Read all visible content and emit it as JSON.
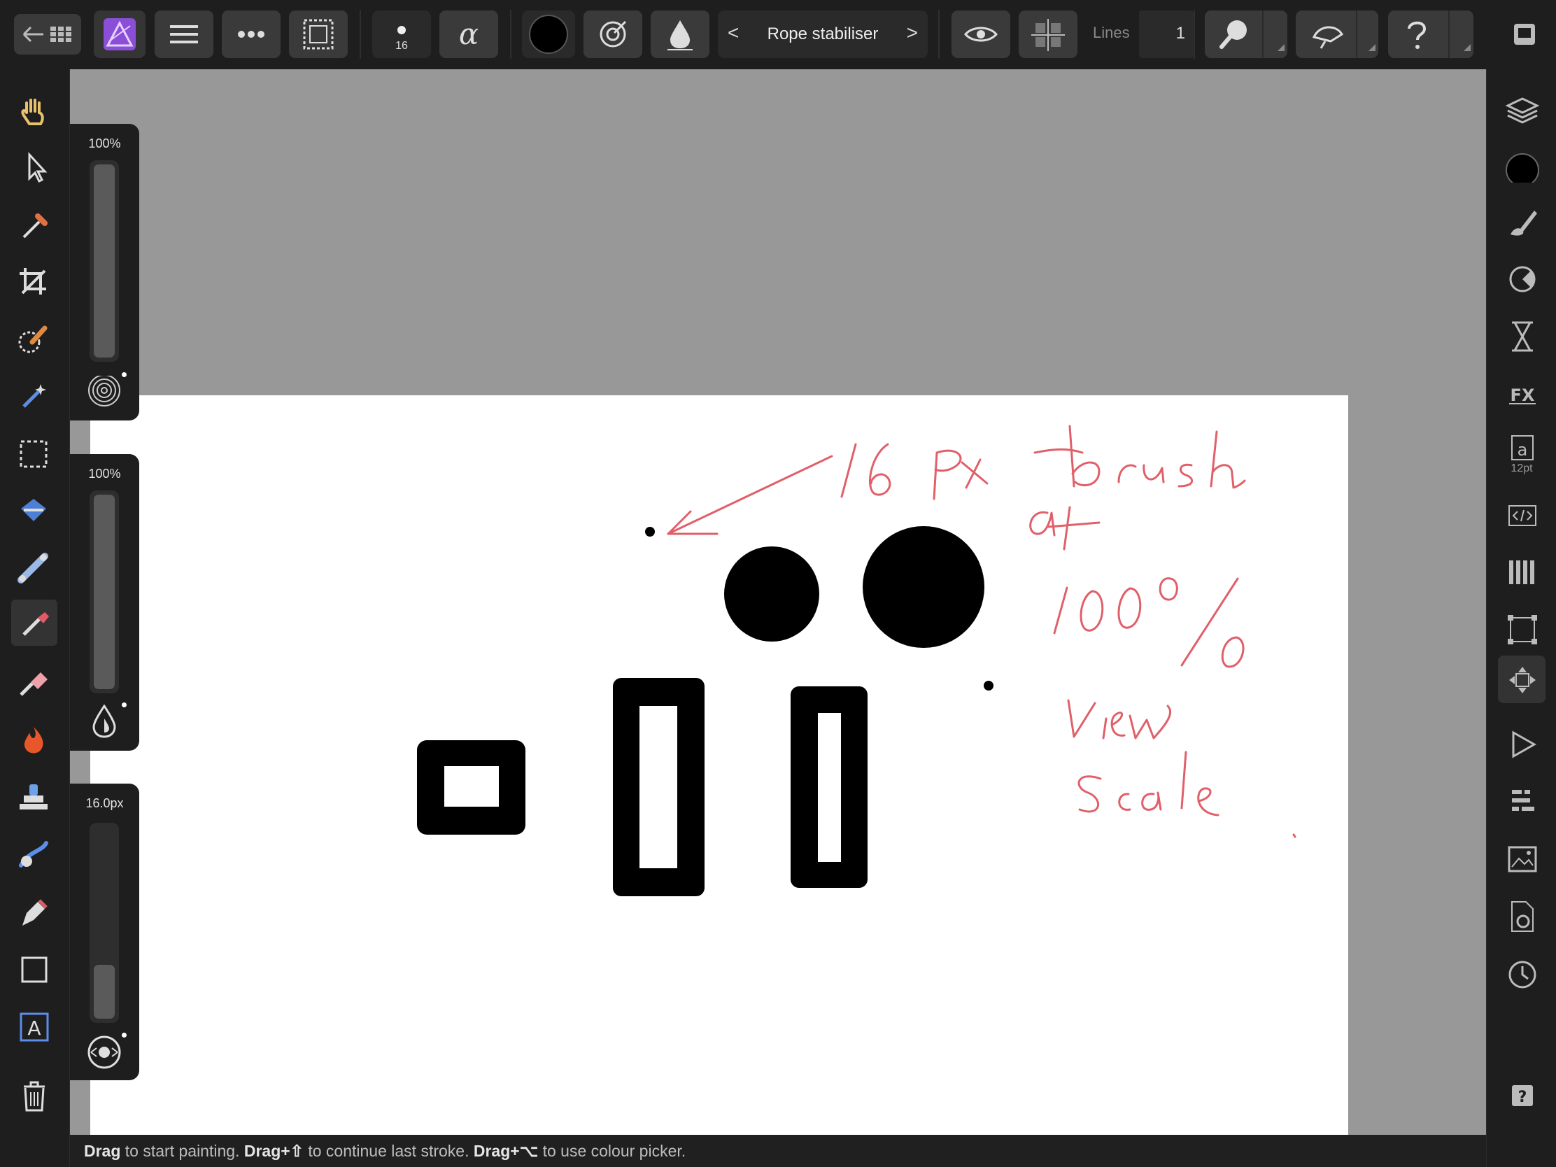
{
  "toolbar": {
    "brush_size_label": "16",
    "stabiliser_label": "Rope stabiliser",
    "prev_label": "<",
    "next_label": ">",
    "lines_label": "Lines",
    "lines_value": "1"
  },
  "left_panels": {
    "opacity_value": "100%",
    "flow_value": "100%",
    "width_value": "16.0px",
    "opacity_fill": 1.0,
    "flow_fill": 1.0,
    "width_fill": 0.28
  },
  "right_tools": {
    "text_size_label": "12pt"
  },
  "status": {
    "drag1": "Drag",
    "part1": " to start painting. ",
    "drag2": "Drag+⇧",
    "part2": " to continue last stroke. ",
    "drag3": "Drag+⌥",
    "part3": " to use colour picker."
  },
  "colors": {
    "annotation": "#e0606a",
    "accent_app": "#8a4fd6"
  },
  "annotation_text": {
    "line1": "16 Px brush",
    "line2": "at",
    "line3": "100%",
    "line4": "View",
    "line5": "Scale."
  },
  "icons": {
    "left": [
      "hand-icon",
      "move-icon",
      "colour-picker-icon",
      "crop-icon",
      "selection-brush-icon",
      "flood-select-icon",
      "marquee-icon",
      "flood-fill-icon",
      "gradient-icon",
      "paint-brush-icon",
      "erase-brush-icon",
      "dodge-burn-icon",
      "clone-icon",
      "smudge-icon",
      "pen-icon",
      "rectangle-icon",
      "text-icon",
      "delete-icon"
    ],
    "right": [
      "layers-icon",
      "colour-icon",
      "brushes-icon",
      "adjustments-icon",
      "stock-icon",
      "effects-icon",
      "text-styles-icon",
      "code-icon",
      "channels-icon",
      "transform-icon",
      "navigator-icon",
      "macros-icon",
      "histogram-icon",
      "library-icon",
      "settings-icon",
      "history-icon",
      "help-icon"
    ]
  }
}
